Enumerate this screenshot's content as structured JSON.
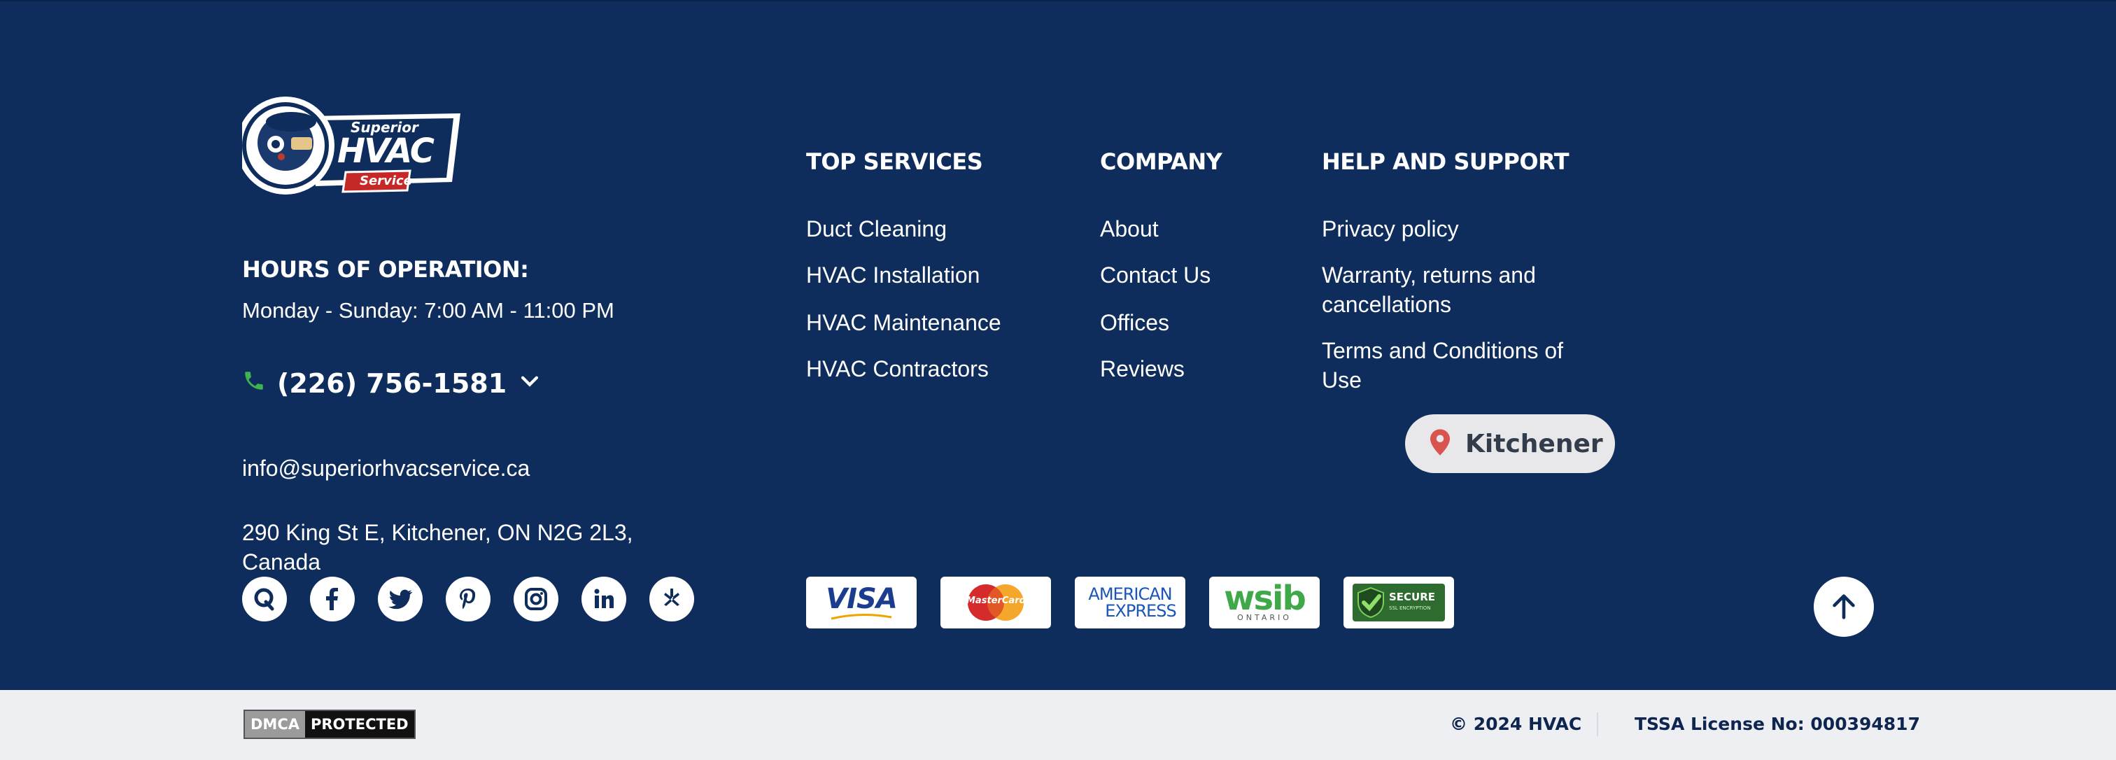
{
  "brand": {
    "logo_top": "Superior",
    "logo_main": "HVAC",
    "logo_tag": "Service"
  },
  "hours": {
    "title": "HOURS OF OPERATION:",
    "text": "Monday - Sunday: 7:00 AM - 11:00 PM"
  },
  "contact": {
    "phone": "(226) 756-1581",
    "email": "info@superiorhvacservice.ca",
    "address_line1": "290 King St E, Kitchener, ON N2G 2L3,",
    "address_line2": "Canada"
  },
  "columns": {
    "top_services": {
      "title": "TOP SERVICES",
      "links": [
        "Duct Cleaning",
        "HVAC Installation",
        "HVAC Maintenance",
        "HVAC Contractors"
      ]
    },
    "company": {
      "title": "COMPANY",
      "links": [
        "About",
        "Contact Us",
        "Offices",
        "Reviews"
      ]
    },
    "help": {
      "title": "HELP AND SUPPORT",
      "links": [
        "Privacy policy",
        "Warranty, returns and cancellations",
        "Terms and Conditions of Use"
      ]
    }
  },
  "location": {
    "label": "Kitchener"
  },
  "social_icons": [
    "quora-icon",
    "facebook-icon",
    "twitter-icon",
    "pinterest-icon",
    "instagram-icon",
    "linkedin-icon",
    "yelp-icon"
  ],
  "payments": {
    "visa": "VISA",
    "mastercard": "MasterCard",
    "amex_line1": "AMERICAN",
    "amex_line2": "EXPRESS",
    "wsib": "wsib",
    "wsib_sub": "ONTARIO",
    "secure": "SECURE",
    "secure_sub": "SSL ENCRYPTION"
  },
  "bottom": {
    "dmca_left": "DMCA",
    "dmca_right": "PROTECTED",
    "copyright": "© 2024 HVAC",
    "license": "TSSA License No: 000394817"
  },
  "colors": {
    "background": "#0e2d5c",
    "bottom_bar": "#eeeff2",
    "phone_icon": "#3fb34f",
    "pin": "#d9534f"
  }
}
